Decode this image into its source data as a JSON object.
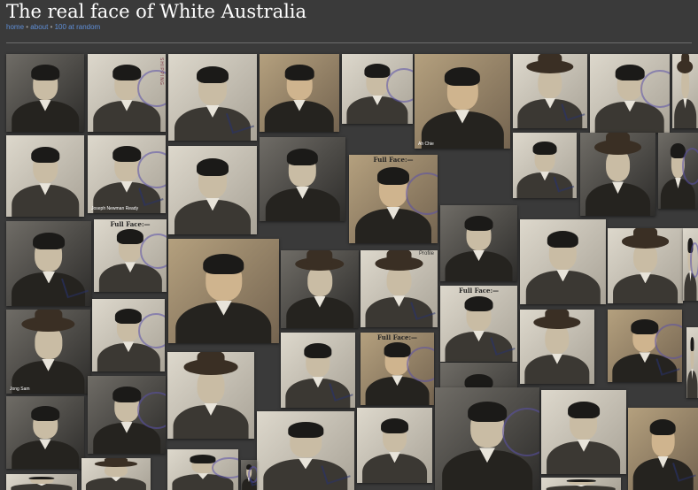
{
  "header": {
    "title": "The real face of White Australia",
    "nav": [
      {
        "label": "home"
      },
      {
        "label": "about"
      },
      {
        "label": "100 at random"
      }
    ],
    "separator": "•"
  },
  "gallery": {
    "accent_link_color": "#5f8fd8",
    "photos": [
      {
        "icon": "portrait-photo"
      },
      {
        "icon": "portrait-photo",
        "stamp_text": "SHIPPING"
      },
      {
        "icon": "portrait-photo"
      },
      {
        "icon": "portrait-photo"
      },
      {
        "icon": "portrait-photo"
      },
      {
        "icon": "portrait-photo",
        "caption": "Ah Chie"
      },
      {
        "icon": "portrait-photo"
      },
      {
        "icon": "portrait-photo"
      },
      {
        "icon": "portrait-photo"
      },
      {
        "icon": "portrait-photo"
      },
      {
        "icon": "portrait-photo",
        "caption": "Joseph Newman Ready"
      },
      {
        "icon": "portrait-photo"
      },
      {
        "icon": "portrait-photo"
      },
      {
        "icon": "portrait-photo",
        "caption": "Full Face:—"
      },
      {
        "icon": "portrait-photo"
      },
      {
        "icon": "portrait-photo"
      },
      {
        "icon": "portrait-photo"
      },
      {
        "icon": "portrait-photo"
      },
      {
        "icon": "portrait-photo"
      },
      {
        "icon": "portrait-photo",
        "caption": "Full Face:—"
      },
      {
        "icon": "portrait-photo"
      },
      {
        "icon": "portrait-photo"
      },
      {
        "icon": "portrait-photo",
        "caption": "Profile"
      },
      {
        "icon": "portrait-photo"
      },
      {
        "icon": "portrait-photo"
      },
      {
        "icon": "portrait-photo"
      },
      {
        "icon": "portrait-photo",
        "caption": "Full Face:—"
      },
      {
        "icon": "portrait-photo",
        "caption": "Jong Sam"
      },
      {
        "icon": "portrait-photo"
      },
      {
        "icon": "portrait-photo"
      },
      {
        "icon": "portrait-photo"
      },
      {
        "icon": "portrait-photo",
        "caption": "Full Face:—"
      },
      {
        "icon": "portrait-photo"
      },
      {
        "icon": "portrait-photo"
      },
      {
        "icon": "portrait-photo"
      },
      {
        "icon": "portrait-photo"
      },
      {
        "icon": "portrait-photo"
      },
      {
        "icon": "portrait-photo"
      },
      {
        "icon": "portrait-photo"
      },
      {
        "icon": "portrait-photo"
      },
      {
        "icon": "portrait-photo"
      },
      {
        "icon": "portrait-photo"
      },
      {
        "icon": "portrait-photo"
      },
      {
        "icon": "portrait-photo"
      },
      {
        "icon": "portrait-photo"
      },
      {
        "icon": "portrait-photo"
      },
      {
        "icon": "portrait-photo"
      },
      {
        "icon": "portrait-photo"
      },
      {
        "icon": "portrait-photo"
      },
      {
        "icon": "portrait-photo"
      }
    ]
  }
}
